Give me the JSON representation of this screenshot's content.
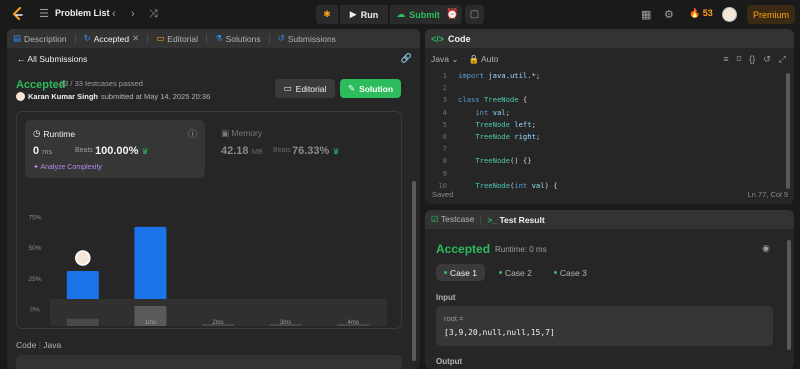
{
  "topbar": {
    "problem_list": "Problem List",
    "run": "Run",
    "submit": "Submit",
    "streak": "53",
    "premium": "Premium"
  },
  "left_tabs": [
    {
      "label": "Description"
    },
    {
      "label": "Accepted"
    },
    {
      "label": "Editorial"
    },
    {
      "label": "Solutions"
    },
    {
      "label": "Submissions"
    }
  ],
  "submission": {
    "all_submissions": "All Submissions",
    "status": "Accepted",
    "testcases": "33 / 33 testcases passed",
    "user": "Karan Kumar Singh",
    "submitted_at": "submitted at May 14, 2025 20:36",
    "editorial_btn": "Editorial",
    "solution_btn": "Solution"
  },
  "runtime": {
    "label": "Runtime",
    "value": "0",
    "unit": "ms",
    "beats_label": "Beats",
    "beats_pct": "100.00%",
    "analyze": "Analyze Complexity"
  },
  "memory": {
    "label": "Memory",
    "value": "42.18",
    "unit": "MB",
    "beats_label": "Beats",
    "beats_pct": "76.33%"
  },
  "chart_data": {
    "type": "bar",
    "categories": [
      "0ms",
      "1ms",
      "2ms",
      "3ms",
      "4ms"
    ],
    "category_labels": [
      "",
      "1ms",
      "2ms",
      "3ms",
      "4ms"
    ],
    "values": [
      31,
      67,
      2,
      2,
      2
    ],
    "yticks": [
      "75%",
      "50%",
      "25%",
      "0%"
    ],
    "ylim": [
      0,
      75
    ],
    "color": "#1a73e8",
    "mini_values": [
      8,
      22,
      2,
      2,
      2
    ]
  },
  "code_section_label": "Code",
  "code_section_lang": "Java",
  "editor": {
    "title": "Code",
    "language": "Java",
    "mode": "Auto",
    "saved": "Saved",
    "position": "Ln 77, Col 9",
    "lines": [
      {
        "n": "1",
        "text": "import java.util.*;"
      },
      {
        "n": "2",
        "text": ""
      },
      {
        "n": "3",
        "text": "class TreeNode {"
      },
      {
        "n": "4",
        "text": "    int val;"
      },
      {
        "n": "5",
        "text": "    TreeNode left;"
      },
      {
        "n": "6",
        "text": "    TreeNode right;"
      },
      {
        "n": "7",
        "text": ""
      },
      {
        "n": "8",
        "text": "    TreeNode() {}"
      },
      {
        "n": "9",
        "text": ""
      },
      {
        "n": "10",
        "text": "    TreeNode(int val) {"
      }
    ]
  },
  "test": {
    "tab_testcase": "Testcase",
    "tab_result": "Test Result",
    "status": "Accepted",
    "runtime": "Runtime: 0 ms",
    "cases": [
      "Case 1",
      "Case 2",
      "Case 3"
    ],
    "input_label": "Input",
    "param_name": "root =",
    "param_value": "[3,9,20,null,null,15,7]",
    "output_label": "Output"
  }
}
